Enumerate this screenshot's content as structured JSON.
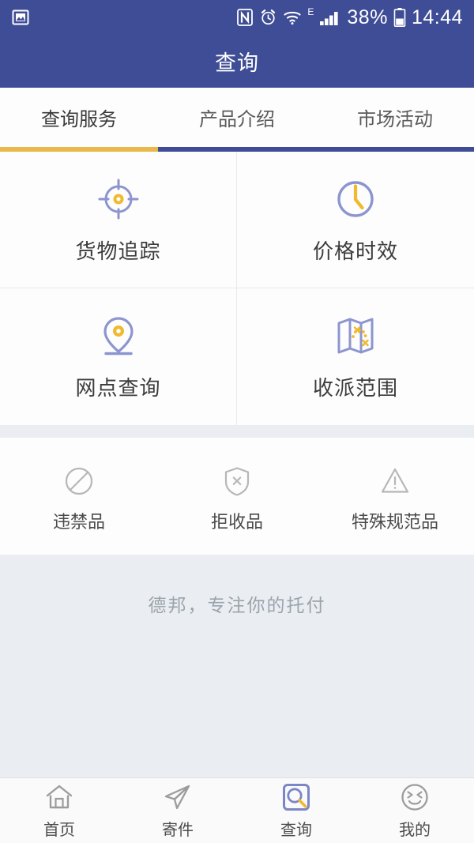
{
  "colors": {
    "header_bg": "#3f4d96",
    "accent_yellow": "#e8b84b",
    "icon_purple": "#8c95cf",
    "icon_gray": "#b7b7b7",
    "page_bg": "#eaeef2",
    "card_bg": "#fdfdfd"
  },
  "statusbar": {
    "left_icons": [
      {
        "name": "screenshot-icon",
        "label": "screenshot"
      }
    ],
    "right_icons": [
      {
        "name": "nfc-icon",
        "label": "N"
      },
      {
        "name": "alarm-clock-icon",
        "label": "alarm"
      },
      {
        "name": "wifi-icon",
        "label": "wifi"
      }
    ],
    "network_type": "E",
    "signal": {
      "name": "signal-bars-icon",
      "bars": 4
    },
    "battery_percent": "38%",
    "battery_icon": "battery-icon",
    "time": "14:44"
  },
  "header": {
    "title": "查询"
  },
  "tabs": [
    {
      "label": "查询服务",
      "active": true
    },
    {
      "label": "产品介绍",
      "active": false
    },
    {
      "label": "市场活动",
      "active": false
    }
  ],
  "services": [
    {
      "label": "货物追踪",
      "icon": "target-crosshair-icon"
    },
    {
      "label": "价格时效",
      "icon": "clock-icon"
    },
    {
      "label": "网点查询",
      "icon": "map-pin-icon"
    },
    {
      "label": "收派范围",
      "icon": "folded-map-icon"
    }
  ],
  "rules": [
    {
      "label": "违禁品",
      "icon": "prohibited-circle-slash-icon"
    },
    {
      "label": "拒收品",
      "icon": "shield-x-icon"
    },
    {
      "label": "特殊规范品",
      "icon": "warning-triangle-icon"
    }
  ],
  "slogan": "德邦，专注你的托付",
  "bottomnav": [
    {
      "label": "首页",
      "icon": "home-icon",
      "active": false
    },
    {
      "label": "寄件",
      "icon": "paper-plane-icon",
      "active": false
    },
    {
      "label": "查询",
      "icon": "search-square-icon",
      "active": true
    },
    {
      "label": "我的",
      "icon": "smiley-face-icon",
      "active": false
    }
  ]
}
